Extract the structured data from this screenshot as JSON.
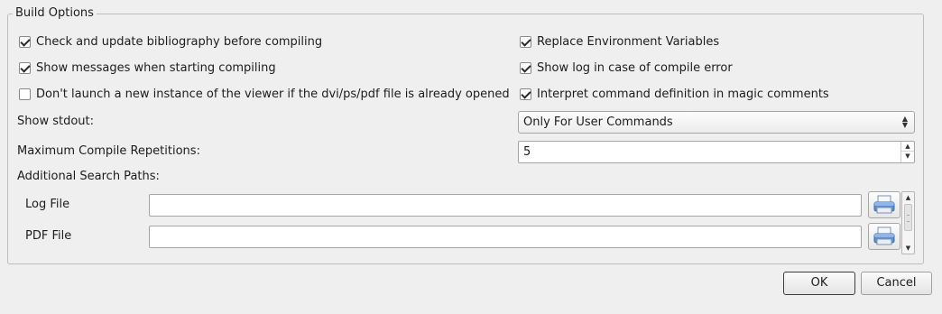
{
  "group": {
    "title": "Build Options"
  },
  "checkboxes": [
    {
      "label": "Check and update bibliography before compiling",
      "checked": true
    },
    {
      "label": "Show messages when starting compiling",
      "checked": true
    },
    {
      "label": "Don't launch a new instance of the viewer if the dvi/ps/pdf file is already opened",
      "checked": false
    },
    {
      "label": "Replace Environment Variables",
      "checked": true
    },
    {
      "label": "Show log in case of compile error",
      "checked": true
    },
    {
      "label": "Interpret command definition in magic comments",
      "checked": true
    }
  ],
  "show_stdout": {
    "label": "Show stdout:",
    "value": "Only For User Commands"
  },
  "max_repetitions": {
    "label": "Maximum Compile Repetitions:",
    "value": "5"
  },
  "search_paths": {
    "label": "Additional Search Paths:",
    "rows": [
      {
        "label": "Log File",
        "value": ""
      },
      {
        "label": "PDF File",
        "value": ""
      }
    ]
  },
  "buttons": {
    "ok": "OK",
    "cancel": "Cancel"
  },
  "icons": {
    "browse": "folder-printer-icon"
  }
}
